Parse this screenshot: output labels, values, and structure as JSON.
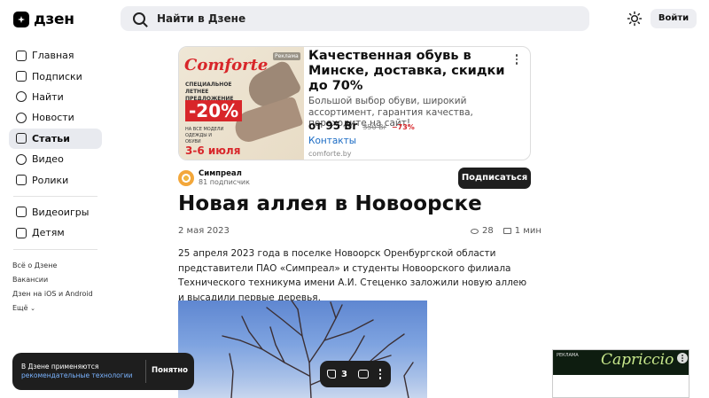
{
  "header": {
    "logo_text": "дзен",
    "search_placeholder": "Найти в Дзене",
    "login_label": "Войти"
  },
  "sidebar": {
    "items": [
      {
        "label": "Главная",
        "icon": "home-icon"
      },
      {
        "label": "Подписки",
        "icon": "subscriptions-icon"
      },
      {
        "label": "Найти",
        "icon": "search-icon"
      },
      {
        "label": "Новости",
        "icon": "news-icon"
      },
      {
        "label": "Статьи",
        "icon": "articles-icon",
        "active": true
      },
      {
        "label": "Видео",
        "icon": "video-icon"
      },
      {
        "label": "Ролики",
        "icon": "clips-icon"
      }
    ],
    "extra_items": [
      {
        "label": "Видеоигры",
        "icon": "gamepad-icon"
      },
      {
        "label": "Детям",
        "icon": "kids-icon"
      }
    ],
    "links": [
      "Всё о Дзене",
      "Вакансии",
      "Дзен на iOS и Android",
      "Ещё"
    ]
  },
  "ad": {
    "image_brand": "Comforte",
    "image_subtitle": "СПЕЦИАЛЬНОЕ ЛЕТНЕЕ ПРЕДЛОЖЕНИЕ",
    "image_discount": "-20%",
    "image_note": "НА ВСЕ МОДЕЛИ ОДЕЖДЫ И ОБУВИ",
    "image_dates": "3-6 июля",
    "image_label": "Реклама",
    "title": "Качественная обувь в Минске, доставка, скидки до 70%",
    "description": "Большой выбор обуви, широкий ассортимент, гарантия качества, переходите на сайт!",
    "price": "от 95 Br",
    "old_price": "350 Br",
    "discount": "−73%",
    "contacts": "Контакты",
    "domain": "comforte.by"
  },
  "channel": {
    "name": "Симпреал",
    "subscribers": "81 подписчик",
    "subscribe_label": "Подписаться"
  },
  "article": {
    "title": "Новая аллея в Новоорске",
    "date": "2 мая 2023",
    "views": "28",
    "read_time": "1 мин",
    "text": "25 апреля 2023 года в поселке Новоорск Оренбургской области представители ПАО «Симпреал» и студенты Новоорского филиала Технического техникума имени А.И. Стеценко заложили новую аллею и высадили первые деревья."
  },
  "reactions": {
    "likes": "3"
  },
  "cookie_toast": {
    "text": "В Дзене применяются",
    "link": "рекомендательные технологии",
    "button": "Понятно"
  },
  "side_ad": {
    "label": "РЕКЛАМА",
    "brand": "Capriccio"
  }
}
